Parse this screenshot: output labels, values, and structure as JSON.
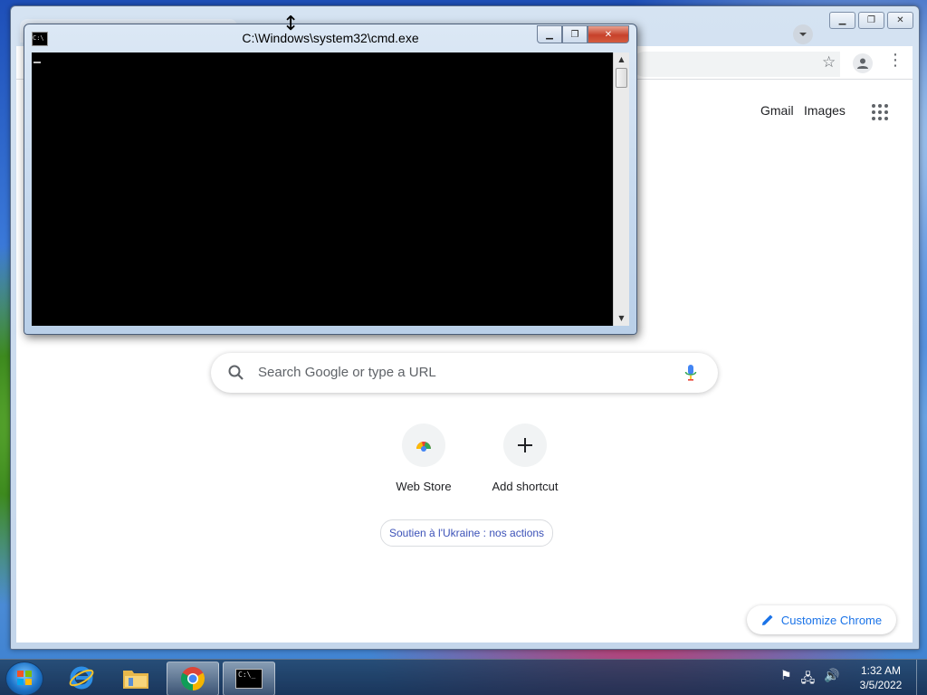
{
  "chrome": {
    "gmail_label": "Gmail",
    "images_label": "Images",
    "search_placeholder": "Search Google or type a URL",
    "shortcuts": [
      {
        "label": "Web Store"
      },
      {
        "label": "Add shortcut"
      }
    ],
    "ukraine_link": "Soutien à l'Ukraine : nos actions",
    "customize_label": "Customize Chrome"
  },
  "cmd": {
    "title": "C:\\Windows\\system32\\cmd.exe",
    "icon_text": "C:\\"
  },
  "taskbar": {
    "time": "1:32 AM",
    "date": "3/5/2022",
    "cmd_icon_text": "C:\\_"
  },
  "colors": {
    "accent_blue": "#1a73e8",
    "console_bg": "#000000",
    "close_red": "#c7412a"
  }
}
